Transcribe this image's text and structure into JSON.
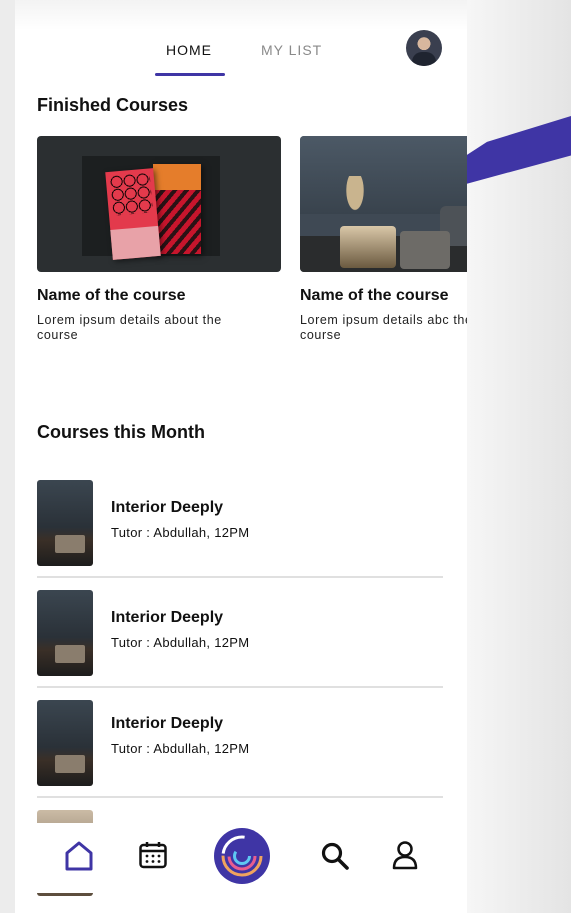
{
  "tabs": {
    "home": "HOME",
    "my_list": "MY LIST",
    "active": "HOME"
  },
  "sections": {
    "finished_title": "Finished Courses",
    "month_title": "Courses this Month"
  },
  "finished_courses": [
    {
      "title": "Name of the course",
      "description": "Lorem ipsum details about the course"
    },
    {
      "title": "Name of the course",
      "description": "Lorem ipsum details abc the course"
    }
  ],
  "monthly_courses": [
    {
      "title": "Interior Deeply",
      "subtitle": "Tutor : Abdullah, 12PM"
    },
    {
      "title": "Interior Deeply",
      "subtitle": "Tutor : Abdullah, 12PM"
    },
    {
      "title": "Interior Deeply",
      "subtitle": "Tutor : Abdullah, 12PM"
    }
  ],
  "nav": {
    "items": [
      {
        "icon": "home-icon",
        "active": true
      },
      {
        "icon": "calendar-icon",
        "active": false
      },
      {
        "icon": "center-logo-icon",
        "active": false
      },
      {
        "icon": "search-icon",
        "active": false
      },
      {
        "icon": "profile-icon",
        "active": false
      }
    ]
  },
  "colors": {
    "accent": "#3f35a5",
    "text": "#111111",
    "muted": "#8a8a8a",
    "divider": "#e0e0e0"
  }
}
